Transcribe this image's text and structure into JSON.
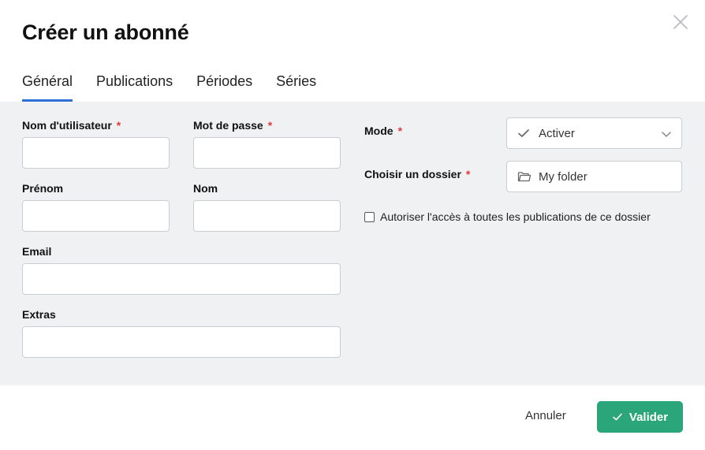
{
  "dialog": {
    "title": "Créer un abonné",
    "close_icon": "close-icon"
  },
  "tabs": [
    {
      "label": "Général",
      "active": true
    },
    {
      "label": "Publications",
      "active": false
    },
    {
      "label": "Périodes",
      "active": false
    },
    {
      "label": "Séries",
      "active": false
    }
  ],
  "form": {
    "username_label": "Nom d'utilisateur",
    "password_label": "Mot de passe",
    "firstname_label": "Prénom",
    "lastname_label": "Nom",
    "email_label": "Email",
    "extras_label": "Extras",
    "mode_label": "Mode",
    "mode_value": "Activer",
    "folder_label": "Choisir un dossier",
    "folder_value": "My folder",
    "checkbox_label": "Autoriser l'accès à toutes les publications de ce dossier",
    "required_mark": "*"
  },
  "footer": {
    "cancel_label": "Annuler",
    "validate_label": "Valider"
  },
  "colors": {
    "accent": "#2f6fd6",
    "primary_button": "#2aa67a",
    "required": "#e03a3a",
    "body_background": "#f0f1f3"
  }
}
